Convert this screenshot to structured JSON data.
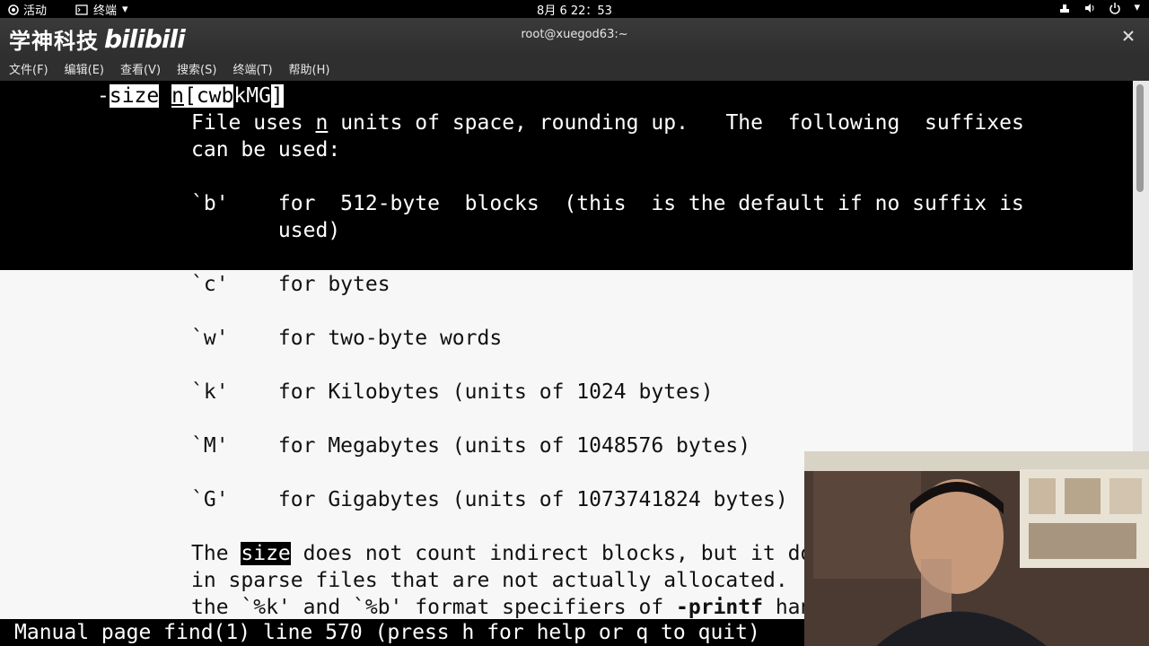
{
  "topbar": {
    "activities": "活动",
    "app_name": "终端",
    "clock": "8月 6  22：53",
    "icons": [
      "network-icon",
      "volume-icon",
      "power-icon"
    ]
  },
  "window": {
    "title": "root@xuegod63:~",
    "logo_text": "学神科技",
    "logo_brand": "bilibili"
  },
  "menubar": [
    "文件(F)",
    "编辑(E)",
    "查看(V)",
    "搜索(S)",
    "终端(T)",
    "帮助(H)"
  ],
  "terminal": {
    "option_dash": "-",
    "option_name": "size",
    "option_arg": "n",
    "option_bracket_open": "[",
    "option_cwb": "cwb",
    "option_kmg": "kMG",
    "option_bracket_close": "]",
    "desc1_pre": "File uses ",
    "desc1_n": "n",
    "desc1_post": " units of space, rounding up.   The  following  suffixes",
    "desc2": "can be used:",
    "b_line": "`b'    for  512-byte  blocks  (this  is the default if no suffix is",
    "b_line2": "       used)",
    "c_line": "`c'    for bytes",
    "w_line": "`w'    for two-byte words",
    "k_line": "`k'    for Kilobytes (units of 1024 bytes)",
    "M_line": "`M'    for Megabytes (units of 1048576 bytes)",
    "G_line": "`G'    for Gigabytes (units of 1073741824 bytes)",
    "para1_pre": "The ",
    "para1_hl": "size",
    "para1_post": " does not count indirect blocks, but it does count blocks",
    "para2": "in sparse files that are not actually allocated.  Bear in mind that",
    "para3_pre": "the `%k' and `%b' format specifiers of ",
    "para3_bold": "-printf",
    "para3_post": " handle sparse files"
  },
  "status_line": "Manual page find(1) line 570 (press h for help or q to quit)"
}
